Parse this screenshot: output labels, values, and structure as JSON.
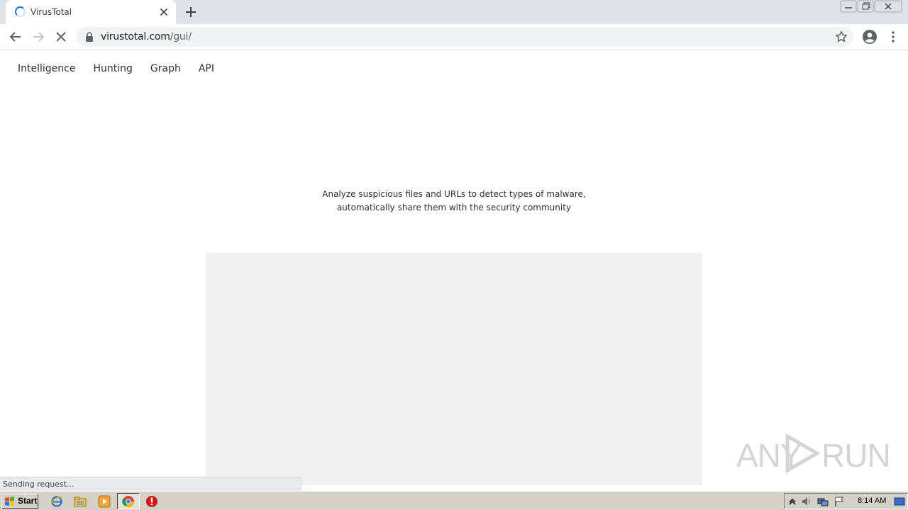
{
  "browser": {
    "tab_title": "VirusTotal",
    "url_host": "virustotal.com",
    "url_path": "/gui/",
    "icons": [
      "loading-spinner",
      "close-icon",
      "plus-icon",
      "back-arrow-icon",
      "forward-arrow-icon",
      "stop-icon",
      "lock-icon",
      "star-icon",
      "account-icon",
      "kebab-menu-icon",
      "minimize-icon",
      "restore-icon",
      "close-window-icon"
    ]
  },
  "page": {
    "nav": [
      "Intelligence",
      "Hunting",
      "Graph",
      "API"
    ],
    "tagline_line1": "Analyze suspicious files and URLs to detect types of malware,",
    "tagline_line2": "automatically share them with the security community"
  },
  "status_text": "Sending request...",
  "watermark": {
    "left": "ANY",
    "right": "RUN"
  },
  "taskbar": {
    "start_label": "Start",
    "clock": "8:14 AM",
    "icons": [
      "ie-icon",
      "explorer-icon",
      "media-player-icon",
      "chrome-icon",
      "stop-sign-icon"
    ]
  },
  "colors": {
    "tabstrip": "#dee1e6",
    "accent_spinner": "#1a73e8",
    "placeholder": "#f1f1f1",
    "taskbar": "#d4d0c8"
  }
}
